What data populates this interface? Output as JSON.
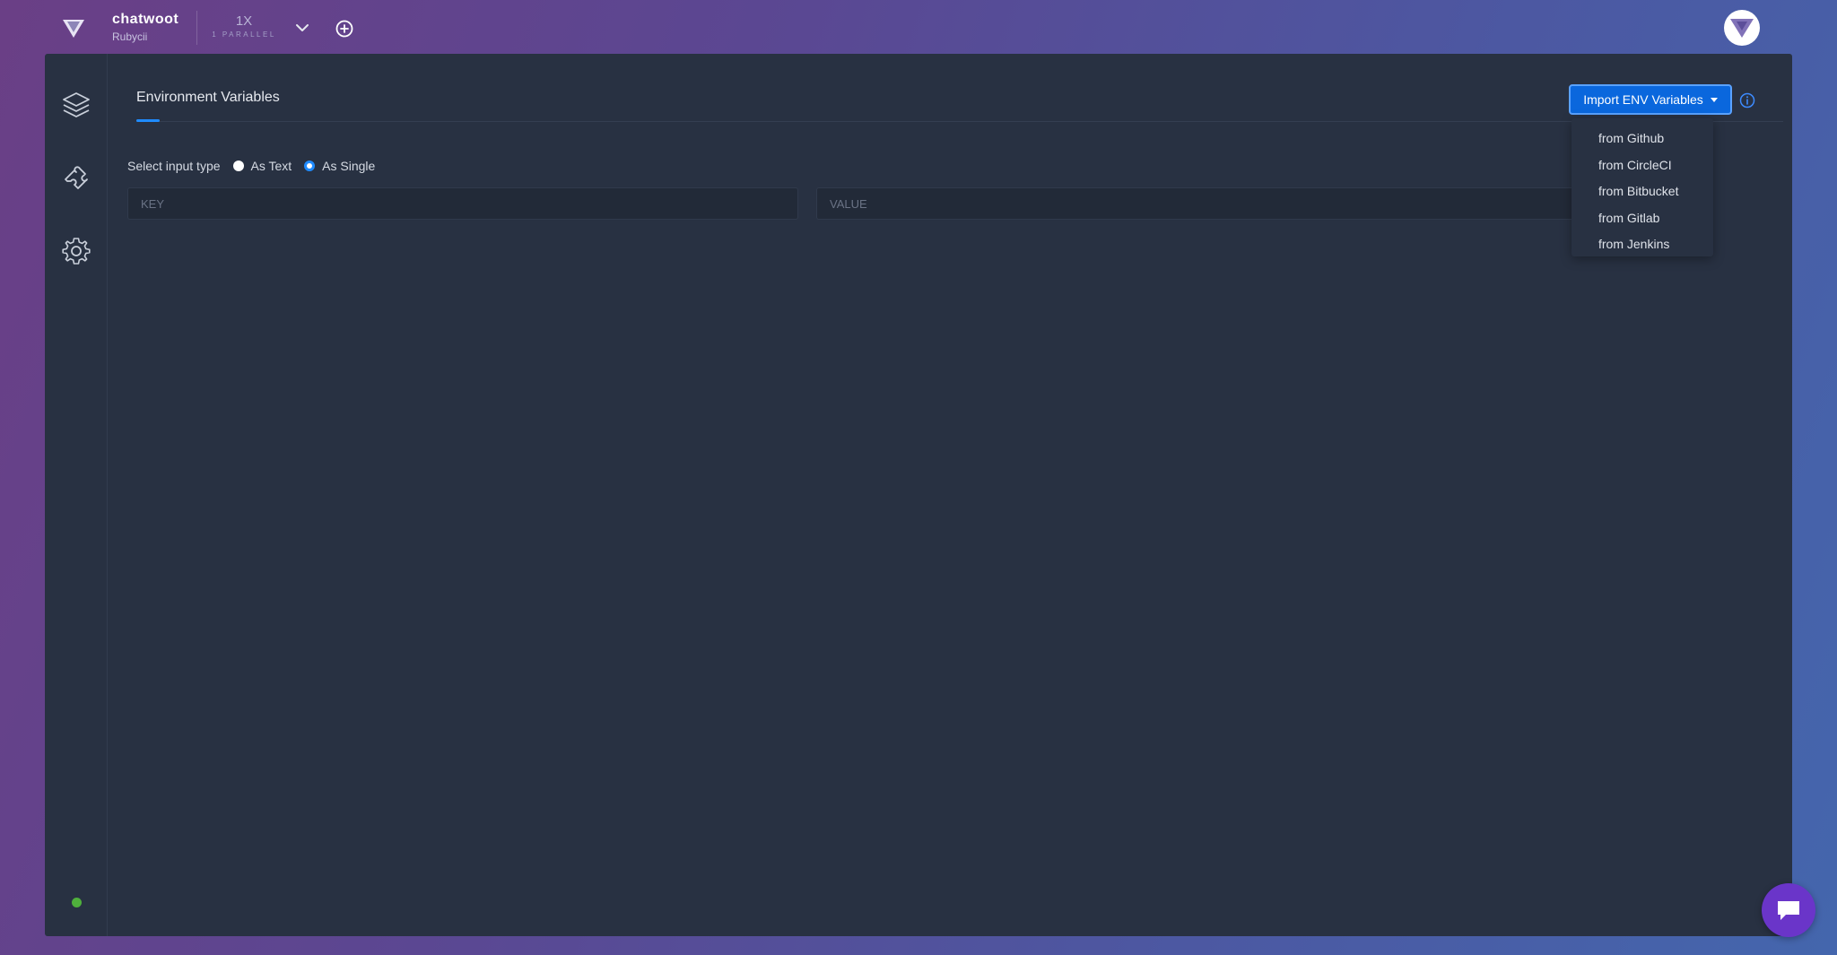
{
  "header": {
    "project_name": "chatwoot",
    "project_sub": "Rubycii",
    "parallel_count": "1X",
    "parallel_label": "1 PARALLEL"
  },
  "sidebar": {
    "items": [
      {
        "icon": "layers-icon"
      },
      {
        "icon": "puzzle-icon"
      },
      {
        "icon": "gear-icon"
      }
    ],
    "status_color": "#4fb03c"
  },
  "main": {
    "tab_title": "Environment Variables",
    "import_button": "Import ENV Variables",
    "import_menu": [
      "from Github",
      "from CircleCI",
      "from Bitbucket",
      "from Gitlab",
      "from Jenkins"
    ],
    "input_type_label": "Select input type",
    "radio_text": "As Text",
    "radio_single": "As Single",
    "selected_input_type": "As Single",
    "key_placeholder": "KEY",
    "value_placeholder": "VALUE"
  },
  "colors": {
    "accent": "#1f8bff",
    "button": "#0a67dd",
    "panel": "#283142",
    "chat": "#6a35c9"
  }
}
